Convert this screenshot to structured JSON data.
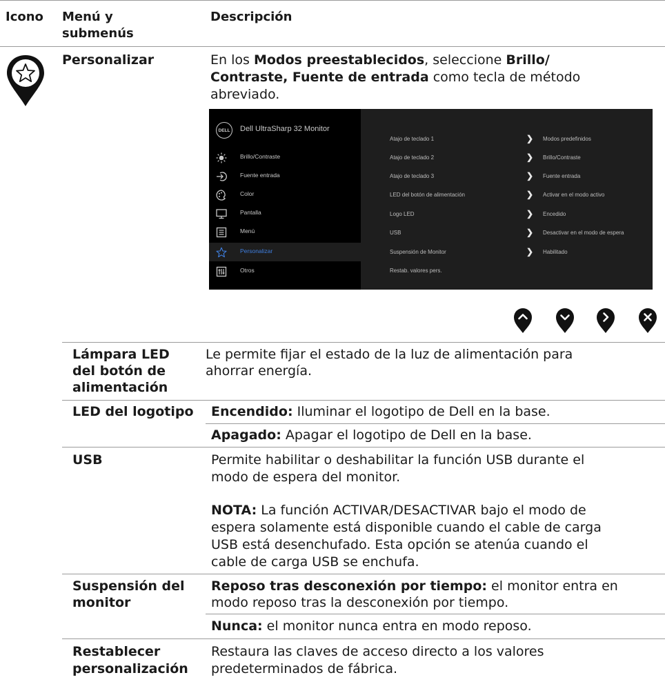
{
  "header": {
    "col1": "Icono",
    "col2_line1": "Menú y",
    "col2_line2": "submenús",
    "col3": "Descripción"
  },
  "personalize": {
    "icon": "star-pin-icon",
    "title": "Personalizar",
    "desc_1a": "En los ",
    "desc_1b": "Modos preestablecidos",
    "desc_1c": ", seleccione ",
    "desc_1d": "Brillo/",
    "desc_2a": "Contraste, Fuente de entrada",
    "desc_2b": " como tecla de método",
    "desc_3": "abreviado."
  },
  "osd": {
    "logo": "DELL",
    "title": "Dell UltraSharp 32 Monitor",
    "menu": [
      {
        "label": "Brillo/Contraste",
        "icon": "brightness-icon"
      },
      {
        "label": "Fuente entrada",
        "icon": "input-icon"
      },
      {
        "label": "Color",
        "icon": "color-icon"
      },
      {
        "label": "Pantalla",
        "icon": "display-icon"
      },
      {
        "label": "Menú",
        "icon": "menu-icon"
      },
      {
        "label": "Personalizar",
        "icon": "star-icon"
      },
      {
        "label": "Otros",
        "icon": "others-icon"
      }
    ],
    "rows": [
      {
        "key": "Atajo de teclado 1",
        "value": "Modos predefinidos"
      },
      {
        "key": "Atajo de teclado 2",
        "value": "Brillo/Contraste"
      },
      {
        "key": "Atajo de teclado 3",
        "value": "Fuente entrada"
      },
      {
        "key": "LED del botón de alimentación",
        "value": "Activar en el modo activo"
      },
      {
        "key": "Logo LED",
        "value": "Encedido"
      },
      {
        "key": "USB",
        "value": "Desactivar en el modo de espera"
      },
      {
        "key": "Suspensión de Monitor",
        "value": "Habilitado"
      },
      {
        "key": "Restab. valores pers.",
        "value": ""
      }
    ]
  },
  "nav_buttons": [
    "up-button-icon",
    "down-button-icon",
    "right-button-icon",
    "close-button-icon"
  ],
  "led": {
    "title_1": "Lámpara LED",
    "title_2": "del botón de",
    "title_3": "alimentación",
    "desc_1": "Le permite fijar el estado de la luz de alimentación para",
    "desc_2": "ahorrar energía."
  },
  "logo_led": {
    "title": "LED del logotipo",
    "on_label": "Encendido:",
    "on_text": " Iluminar el logotipo de Dell en la base.",
    "off_label": "Apagado:",
    "off_text": " Apagar el logotipo de Dell en la base."
  },
  "usb": {
    "title": "USB",
    "desc_1": "Permite habilitar o deshabilitar la función USB durante el",
    "desc_2": "modo de espera del monitor.",
    "note_label": "NOTA:",
    "note_1": " La función ACTIVAR/DESACTIVAR bajo el modo de",
    "note_2": "espera solamente está disponible cuando el cable de carga",
    "note_3": "USB está desenchufado. Esta opción se atenúa cuando el",
    "note_4": "cable de carga USB se enchufa."
  },
  "sleep": {
    "title_1": "Suspensión del",
    "title_2": "monitor",
    "a_label": "Reposo tras desconexión por tiempo:",
    "a_text": " el monitor entra en",
    "a_text2": "modo reposo tras la desconexión por tiempo.",
    "b_label": "Nunca:",
    "b_text": " el monitor nunca entra en modo reposo."
  },
  "reset": {
    "title_1": "Restablecer",
    "title_2": "personalización",
    "desc_1": "Restaura las claves de acceso directo a los valores",
    "desc_2": "predeterminados de fábrica."
  }
}
